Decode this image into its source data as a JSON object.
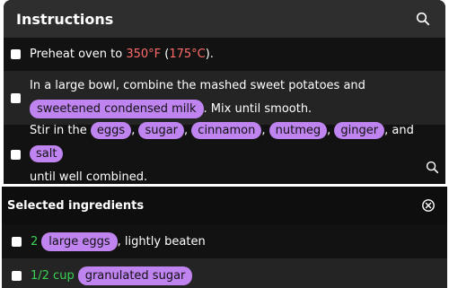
{
  "instructions": {
    "title": "Instructions",
    "search_icon": "search-icon",
    "steps": [
      {
        "prefix": "Preheat oven to",
        "temp_f": "350°F",
        "paren_open": "(",
        "temp_c": "175°C",
        "paren_close": ")."
      },
      {
        "text1": "In a large bowl, combine the mashed sweet potatoes and",
        "ingredient": "sweetened condensed milk",
        "text2": ". Mix until smooth."
      },
      {
        "prefix": "Stir in the",
        "ingredients": [
          "eggs",
          "sugar",
          "cinnamon",
          "nutmeg",
          "ginger",
          "salt"
        ],
        "and_word": ", and",
        "suffix": "until well combined."
      }
    ]
  },
  "selected_ingredients": {
    "title": "Selected ingredients",
    "close_icon": "close-circle-icon",
    "items": [
      {
        "qty": "2",
        "name": "large eggs",
        "note": ", lightly beaten"
      },
      {
        "qty": "1/2 cup",
        "name": "granulated sugar",
        "note": ""
      }
    ]
  },
  "colors": {
    "panel_bg": "#121212",
    "header_bg": "#2e2e2e",
    "pill": "#bf84f0",
    "temperature": "#ff6b6b",
    "quantity": "#39d353"
  }
}
